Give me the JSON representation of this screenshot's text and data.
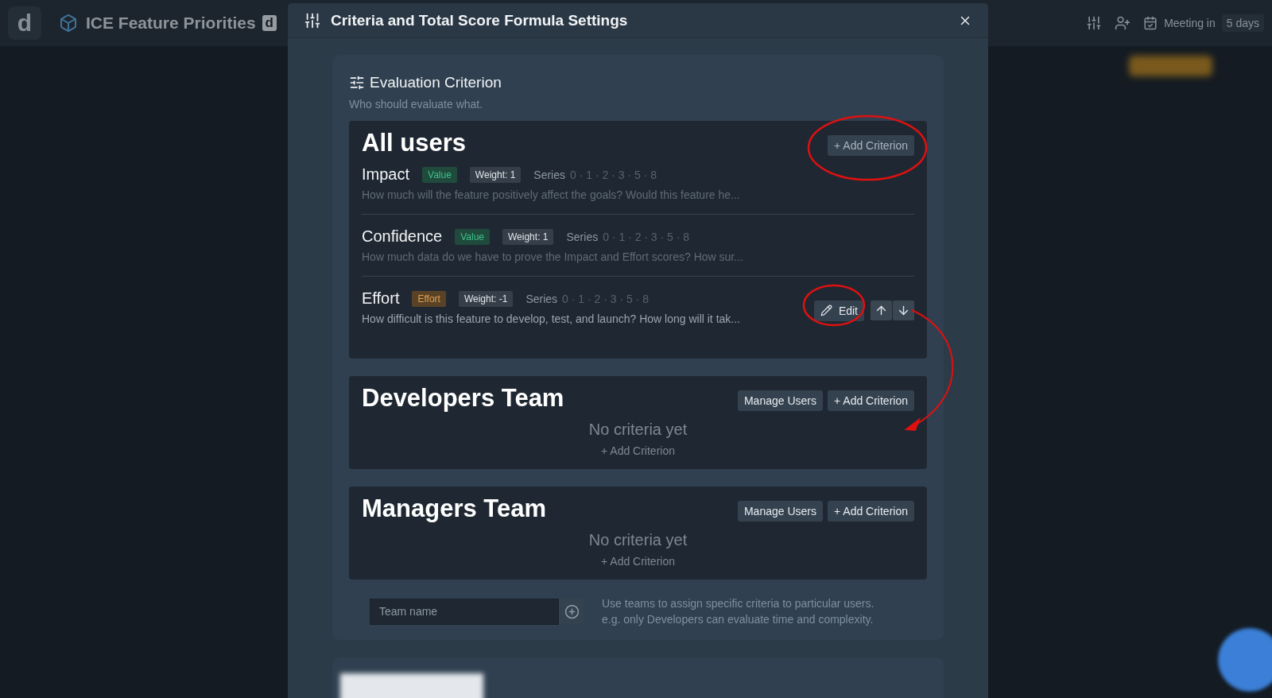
{
  "app_header": {
    "logo": "d",
    "title": "ICE Feature Priorities",
    "badge": "d",
    "meeting_label": "Meeting in",
    "meeting_value": "5 days"
  },
  "modal": {
    "title": "Criteria and Total Score Formula Settings",
    "section": {
      "title": "Evaluation Criterion",
      "subtitle": "Who should evaluate what.",
      "groups": [
        {
          "name": "All users",
          "buttons": [
            "+ Add Criterion"
          ],
          "criteria": [
            {
              "name": "Impact",
              "tag": {
                "label": "Value",
                "kind": "value"
              },
              "weight": "Weight: 1",
              "series_label": "Series",
              "series_values": "0 · 1 · 2 · 3 · 5 · 8",
              "description": "How much will the feature positively affect the goals? Would this feature he..."
            },
            {
              "name": "Confidence",
              "tag": {
                "label": "Value",
                "kind": "value"
              },
              "weight": "Weight: 1",
              "series_label": "Series",
              "series_values": "0 · 1 · 2 · 3 · 5 · 8",
              "description": "How much data do we have to prove the Impact and Effort scores? How sur..."
            },
            {
              "name": "Effort",
              "tag": {
                "label": "Effort",
                "kind": "effort"
              },
              "weight": "Weight: -1",
              "series_label": "Series",
              "series_values": "0 · 1 · 2 · 3 · 5 · 8",
              "description": "How difficult is this feature to develop, test, and launch? How long will it tak...",
              "edit_button": "Edit"
            }
          ]
        },
        {
          "name": "Developers Team",
          "buttons": [
            "Manage Users",
            "+ Add Criterion"
          ],
          "empty_text": "No criteria yet",
          "empty_action": "+ Add Criterion"
        },
        {
          "name": "Managers Team",
          "buttons": [
            "Manage Users",
            "+ Add Criterion"
          ],
          "empty_text": "No criteria yet",
          "empty_action": "+ Add Criterion"
        }
      ],
      "team_input": {
        "placeholder": "Team name"
      },
      "hint": [
        "Use teams to assign specific criteria to particular users.",
        "e.g. only Developers can evaluate time and complexity."
      ]
    }
  }
}
